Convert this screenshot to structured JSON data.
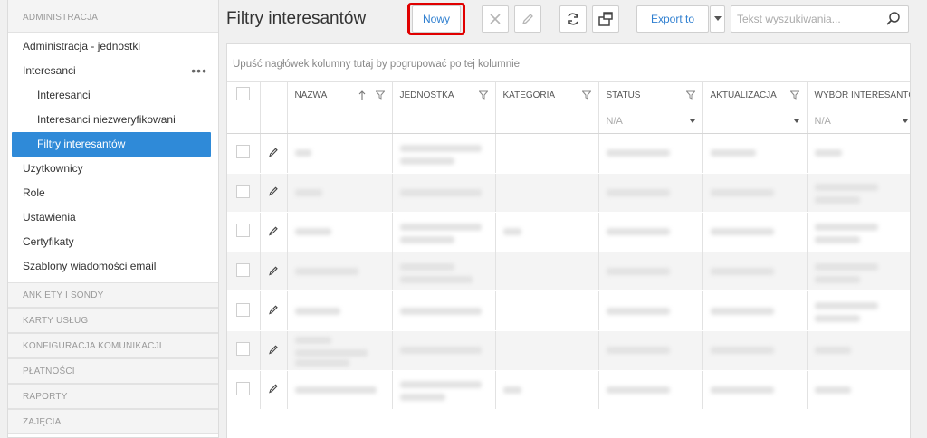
{
  "sidebar": {
    "admin_header": "ADMINISTRACJA",
    "items": [
      {
        "label": "Administracja - jednostki"
      },
      {
        "label": "Interesanci",
        "more": "•••"
      },
      {
        "label": "Interesanci"
      },
      {
        "label": "Interesanci niezweryfikowani"
      },
      {
        "label": "Filtry interesantów"
      },
      {
        "label": "Użytkownicy"
      },
      {
        "label": "Role"
      },
      {
        "label": "Ustawienia"
      },
      {
        "label": "Certyfikaty"
      },
      {
        "label": "Szablony wiadomości email"
      }
    ],
    "sections": [
      "ANKIETY I SONDY",
      "KARTY USŁUG",
      "KONFIGURACJA KOMUNIKACJI",
      "PŁATNOŚCI",
      "RAPORTY",
      "ZAJĘCIA"
    ]
  },
  "header": {
    "title": "Filtry interesantów",
    "new_label": "Nowy",
    "export_label": "Export to",
    "search_placeholder": "Tekst wyszukiwania..."
  },
  "grid": {
    "group_hint": "Upuść nagłówek kolumny tutaj by pogrupować po tej kolumnie",
    "columns": [
      "NAZWA",
      "JEDNOSTKA",
      "KATEGORIA",
      "STATUS",
      "AKTUALIZACJA",
      "WYBÓR INTERESANTÓW"
    ],
    "filter_status": "N/A",
    "filter_wybor": "N/A"
  },
  "colors": {
    "accent": "#2f8ad8",
    "highlight": "#e00000",
    "link": "#2f7fd0"
  }
}
